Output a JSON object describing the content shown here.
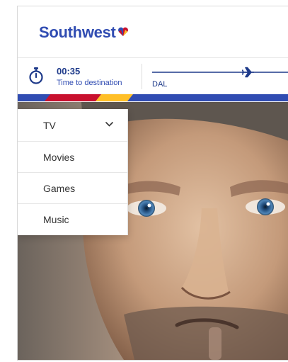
{
  "brand": {
    "name": "Southwest",
    "colors": {
      "blue": "#304cb2",
      "red": "#c8102e",
      "yellow": "#ffbf27"
    }
  },
  "flight": {
    "time_to_destination": "00:35",
    "time_label": "Time to destination",
    "origin": "DAL",
    "icons": {
      "timer": "stopwatch-icon",
      "plane": "airplane-icon"
    }
  },
  "menu": {
    "items": [
      {
        "label": "TV",
        "expandable": true
      },
      {
        "label": "Movies"
      },
      {
        "label": "Games"
      },
      {
        "label": "Music"
      }
    ]
  }
}
